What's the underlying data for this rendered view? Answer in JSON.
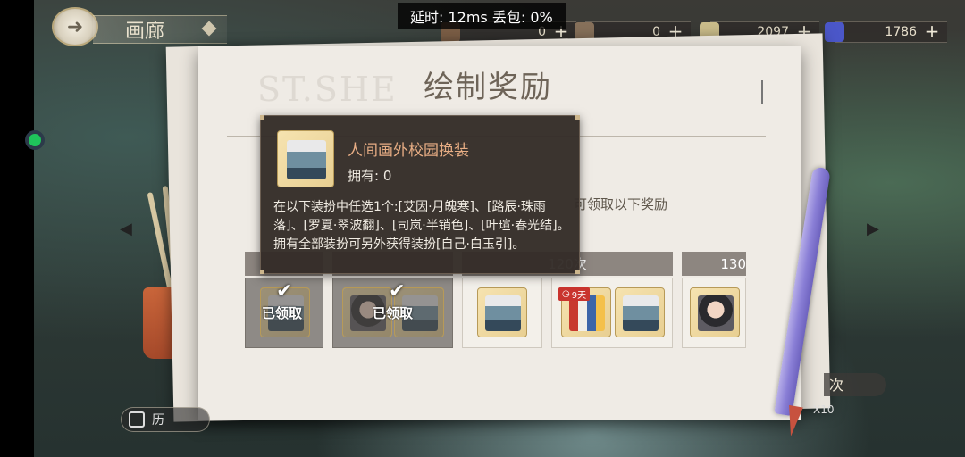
{
  "top_bar": {
    "back_icon": "back-arrow-icon",
    "section_label": "画廊",
    "latency_text": "延时: 12ms 丢包: 0%",
    "resources": [
      {
        "value": "0",
        "plus": "+"
      },
      {
        "value": "0",
        "plus": "+"
      },
      {
        "value": "2097",
        "plus": "+"
      },
      {
        "value": "1786",
        "plus": "+"
      }
    ]
  },
  "panel": {
    "title": "绘制奖励",
    "stamp_text": "ST.SHE",
    "hint_text": "可领取以下奖励"
  },
  "milestones": [
    {
      "label": ""
    },
    {
      "label": ""
    },
    {
      "label": "120次"
    },
    {
      "label": "130"
    }
  ],
  "slots": {
    "claimed_label": "已领取",
    "timer_text": "9天"
  },
  "tooltip": {
    "item_name": "人间画外校园换装",
    "owned_text": "拥有: 0",
    "description": "在以下装扮中任选1个:[艾因·月魄寒]、[路辰·珠雨落]、[罗夏·翠波翻]、[司岚·半销色]、[叶瑄·春光结]。拥有全部装扮可另外获得装扮[自己·白玉引]。"
  },
  "bottom": {
    "left_button_label": "历",
    "right_tab_label": "次",
    "multiplier_text": "X10"
  },
  "colors": {
    "title": "#6e6458",
    "tooltip_name": "#e7ad84",
    "milestone_header": "#8d8680",
    "timer_badge": "#c9342e",
    "pen": "#8a7fd6"
  }
}
